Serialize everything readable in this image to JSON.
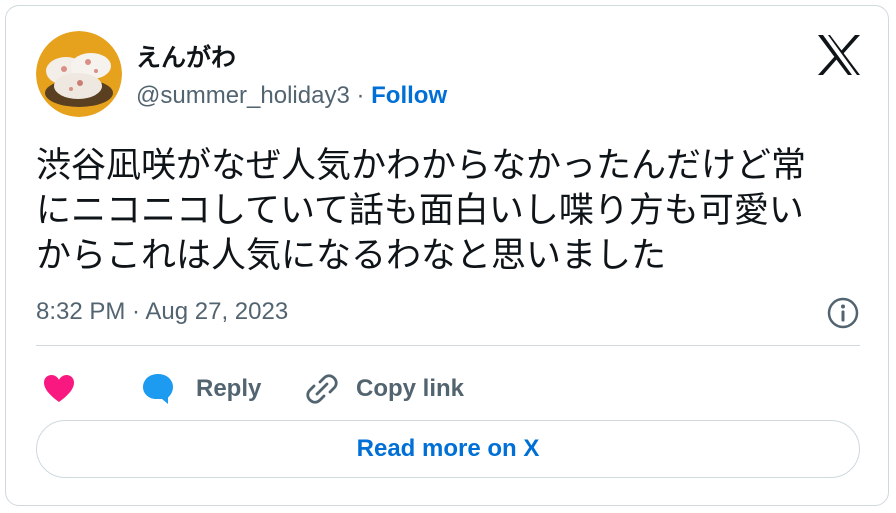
{
  "author": {
    "display_name": "えんがわ",
    "handle": "@summer_holiday3",
    "separator": " · ",
    "follow_label": "Follow",
    "avatar_icon": "sushi-avatar-icon"
  },
  "tweet": {
    "lines": [
      "渋谷凪咲がなぜ人気かわからなかったんだけど常",
      "にニコニコしていて話も面白いし喋り方も可愛い",
      "からこれは人気になるわなと思いました"
    ],
    "timestamp": "8:32 PM · Aug 27, 2023"
  },
  "actions": {
    "like_icon": "heart-icon",
    "reply_label": "Reply",
    "copy_link_label": "Copy link"
  },
  "footer": {
    "read_more_label": "Read more on X"
  },
  "colors": {
    "text": "#0f1419",
    "secondary": "#536471",
    "link": "#006fd6",
    "like": "#f91880",
    "reply": "#1d9bf0",
    "border": "#cfd9de"
  }
}
